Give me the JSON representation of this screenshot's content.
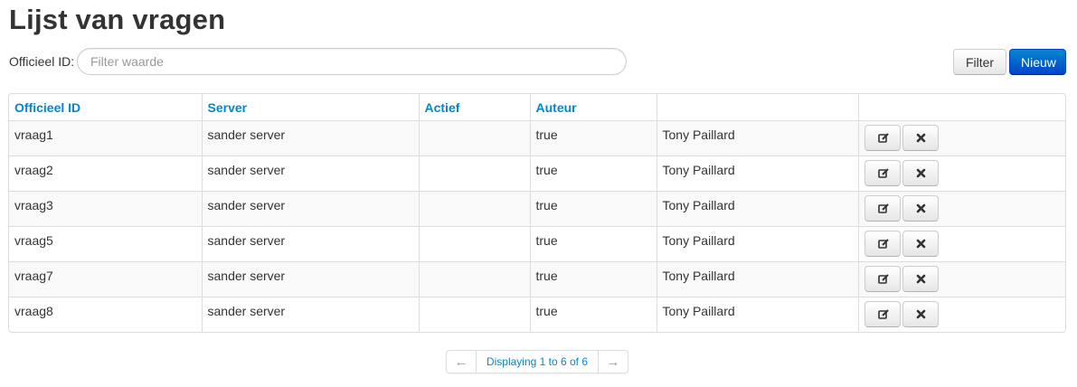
{
  "page": {
    "title": "Lijst van vragen"
  },
  "filter": {
    "label": "Officieel ID:",
    "placeholder": "Filter waarde",
    "value": "",
    "filter_button": "Filter",
    "new_button": "Nieuw"
  },
  "table": {
    "columns": [
      "Officieel ID",
      "Server",
      "Actief",
      "Auteur",
      ""
    ],
    "rows": [
      [
        "vraag1",
        "sander server",
        "",
        "true",
        "Tony Paillard"
      ],
      [
        "vraag2",
        "sander server",
        "",
        "true",
        "Tony Paillard"
      ],
      [
        "vraag3",
        "sander server",
        "",
        "true",
        "Tony Paillard"
      ],
      [
        "vraag5",
        "sander server",
        "",
        "true",
        "Tony Paillard"
      ],
      [
        "vraag7",
        "sander server",
        "",
        "true",
        "Tony Paillard"
      ],
      [
        "vraag8",
        "sander server",
        "",
        "true",
        "Tony Paillard"
      ]
    ],
    "row_actions": [
      "edit-icon",
      "delete-icon"
    ]
  },
  "pagination": {
    "prev": "←",
    "info": "Displaying 1 to 6 of 6",
    "next": "→"
  },
  "colors": {
    "accent": "#0088cc",
    "primary_button": "#0055cc",
    "border": "#dddddd",
    "stripe": "#f9f9f9"
  }
}
